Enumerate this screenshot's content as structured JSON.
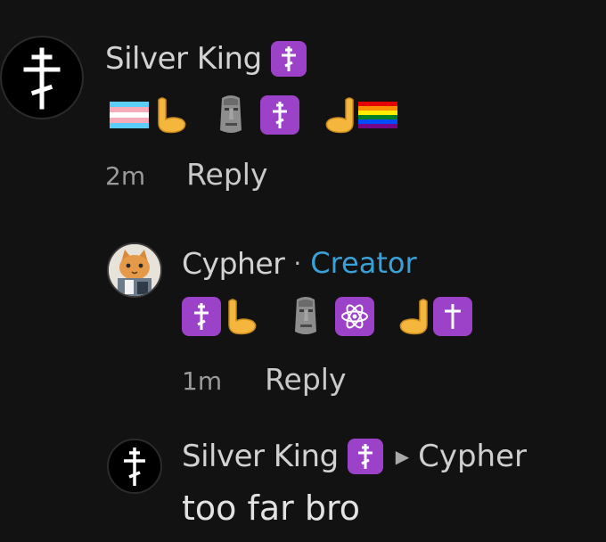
{
  "comments": [
    {
      "author": "Silver King",
      "author_badge_icon": "orthodox-cross-icon",
      "emojis": [
        "transgender-flag-icon",
        "palm-pushing-left-icon",
        "moai-icon",
        "orthodox-cross-icon",
        "palm-pushing-right-icon",
        "rainbow-flag-icon"
      ],
      "time": "2m",
      "reply_label": "Reply"
    },
    {
      "author": "Cypher",
      "separator": "·",
      "role": "Creator",
      "emojis": [
        "orthodox-cross-icon",
        "palm-pushing-left-icon",
        "moai-icon",
        "atom-icon",
        "palm-pushing-right-icon",
        "latin-cross-icon"
      ],
      "time": "1m",
      "reply_label": "Reply"
    },
    {
      "author": "Silver King",
      "author_badge_icon": "orthodox-cross-icon",
      "reply_arrow": "▶",
      "reply_to": "Cypher",
      "text": "too far bro"
    }
  ],
  "colors": {
    "background": "#121212",
    "badge_purple": "#9c42c9",
    "creator_blue": "#3aa0d8",
    "palm_yellow": "#f4b63c"
  }
}
